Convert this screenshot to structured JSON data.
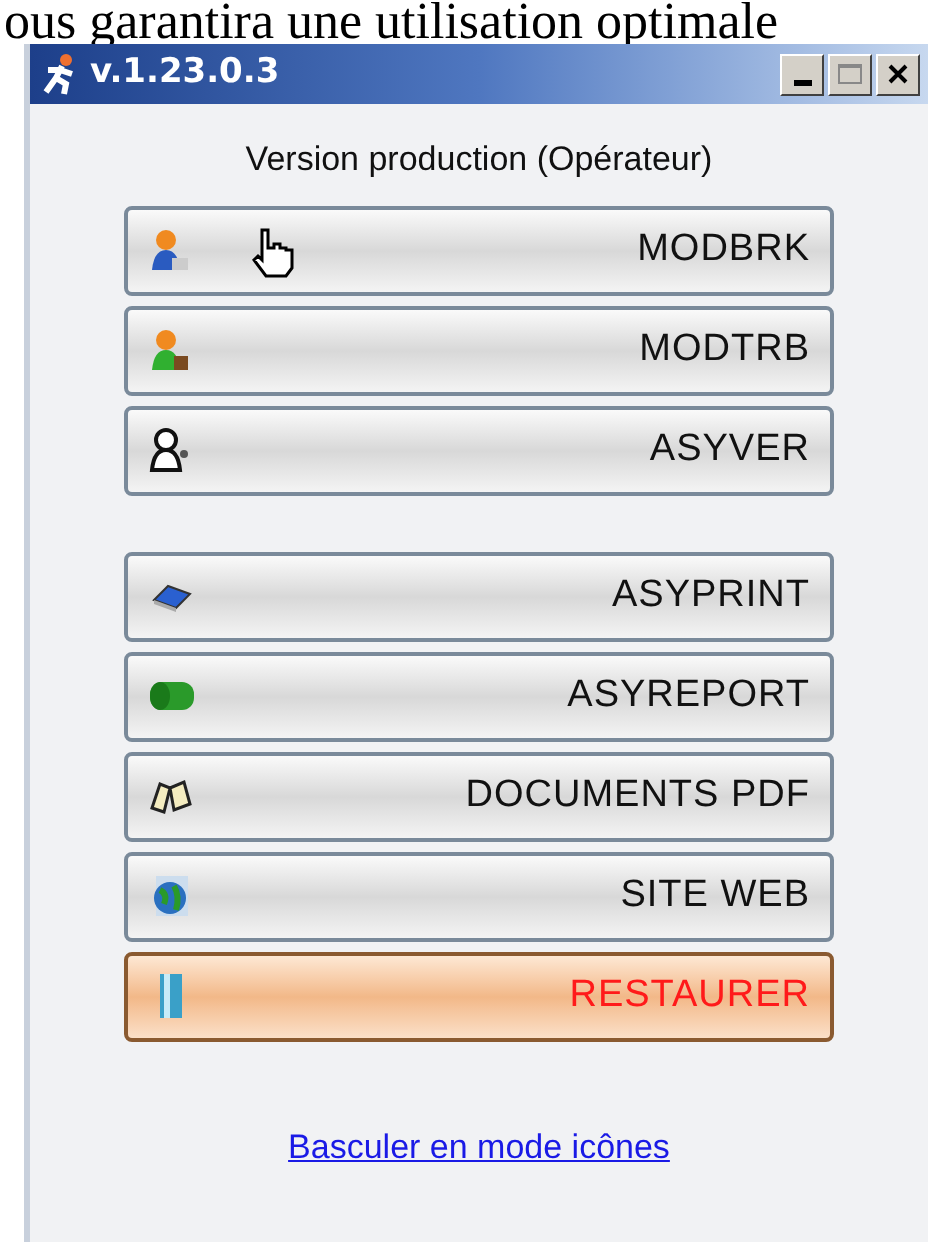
{
  "background_text": "ous garantira une utilisation optimale",
  "window": {
    "title": "v.1.23.0.3"
  },
  "subtitle": "Version production (Opérateur)",
  "button_groups": [
    {
      "buttons": [
        {
          "label": "MODBRK",
          "kind": "normal"
        },
        {
          "label": "MODTRB",
          "kind": "normal"
        },
        {
          "label": "ASYVER",
          "kind": "normal"
        }
      ]
    },
    {
      "buttons": [
        {
          "label": "ASYPRINT",
          "kind": "normal"
        },
        {
          "label": "ASYREPORT",
          "kind": "normal"
        },
        {
          "label": "DOCUMENTS PDF",
          "kind": "normal"
        },
        {
          "label": "SITE WEB",
          "kind": "normal"
        },
        {
          "label": "RESTAURER",
          "kind": "warning"
        }
      ]
    }
  ],
  "link": "Basculer en mode icônes"
}
